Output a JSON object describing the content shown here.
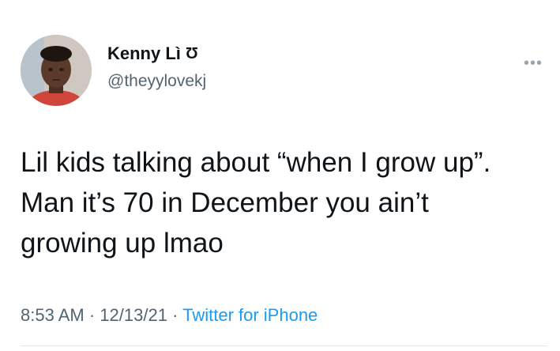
{
  "tweet": {
    "author": {
      "display_name": "Kenny Lì",
      "name_symbol": "Ʊ",
      "handle": "@theyylovekj",
      "avatar_icon": "profile-photo"
    },
    "text": "Lil kids talking about “when I grow up”. Man it’s 70 in December you ain’t growing up lmao",
    "time": "8:53 AM",
    "separator": "·",
    "date": "12/13/21",
    "source": "Twitter for iPhone",
    "more_icon": "more-options-icon",
    "colors": {
      "text": "#0f1419",
      "secondary": "#536471",
      "link": "#1d9bf0"
    }
  }
}
